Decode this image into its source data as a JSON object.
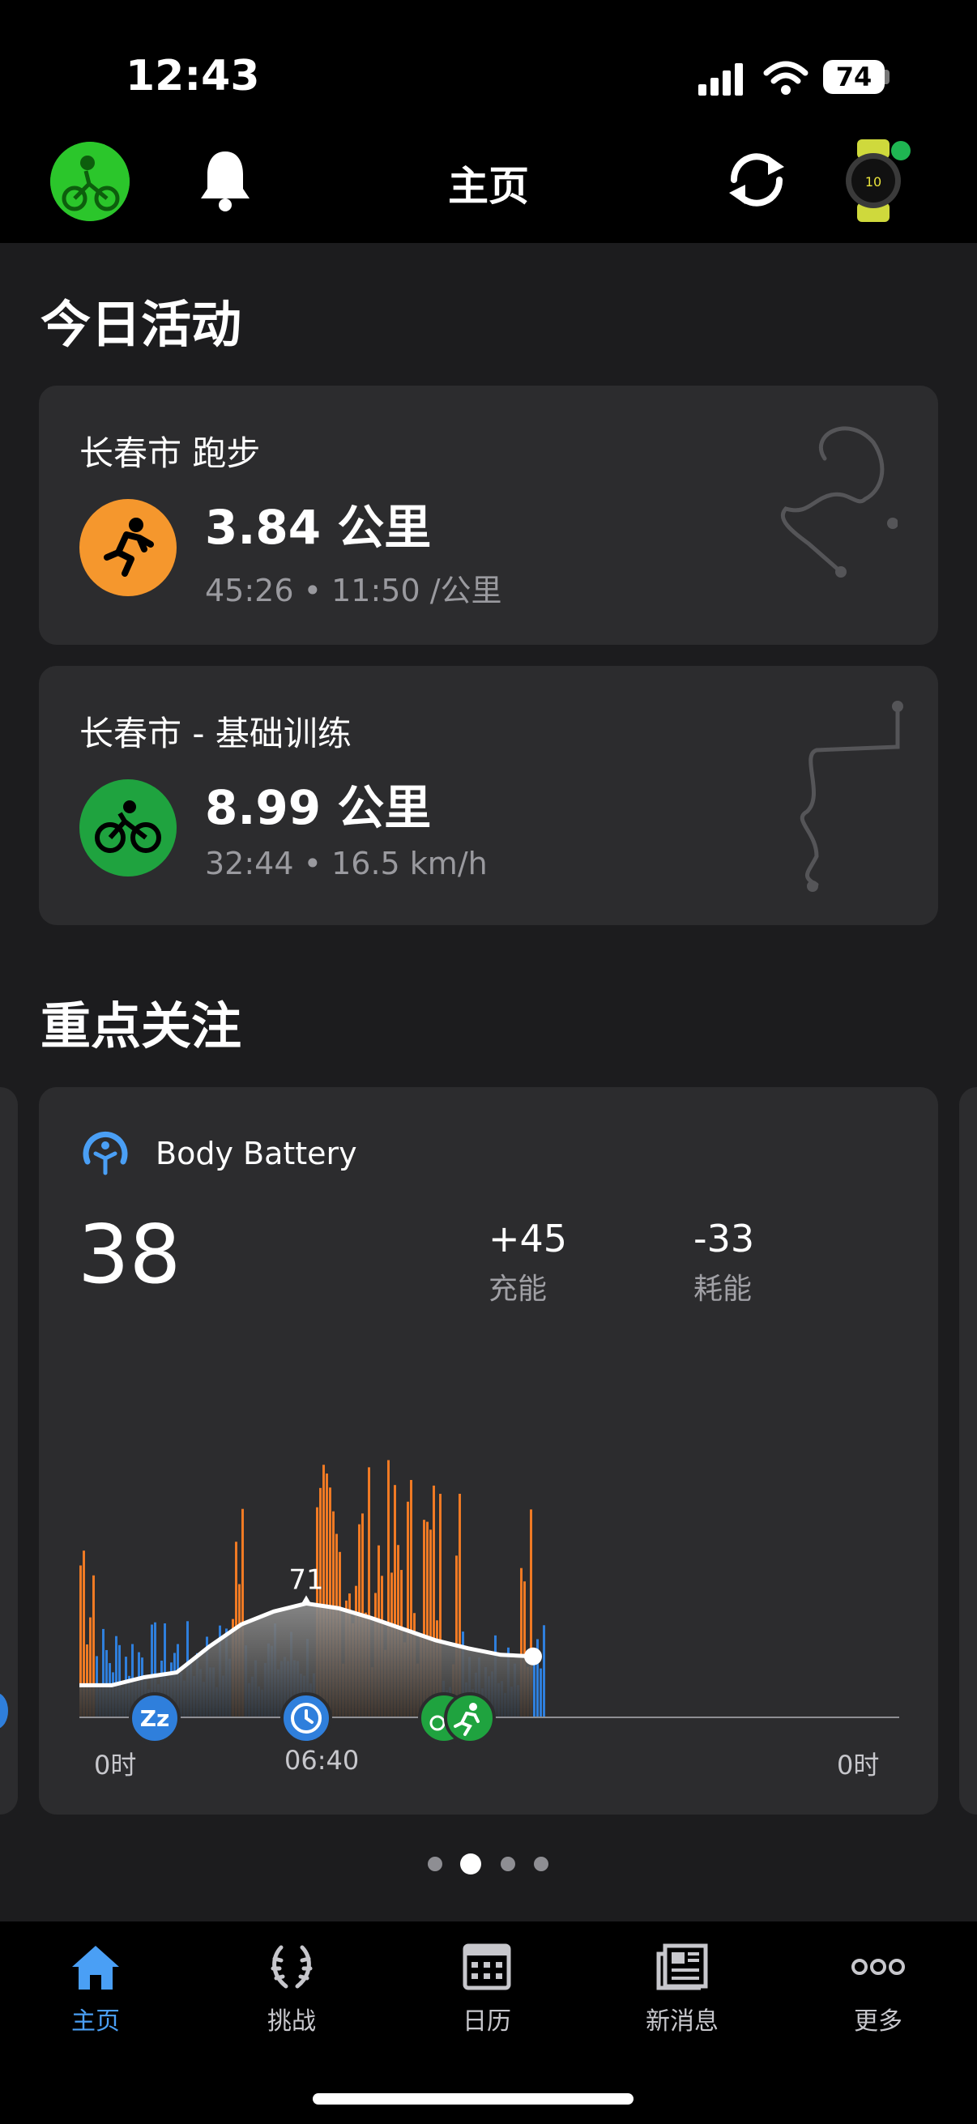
{
  "status_bar": {
    "time": "12:43",
    "battery": "74"
  },
  "header": {
    "title": "主页"
  },
  "today": {
    "section_title": "今日活动",
    "activities": [
      {
        "title": "长春市 跑步",
        "distance": "3.84 公里",
        "duration": "45:26",
        "pace": "11:50 /公里",
        "icon": "run-icon",
        "color": "#f5972d"
      },
      {
        "title": "长春市 - 基础训练",
        "distance": "8.99 公里",
        "duration": "32:44",
        "pace": "16.5 km/h",
        "icon": "bike-icon",
        "color": "#1fa33f"
      }
    ]
  },
  "focus": {
    "section_title": "重点关注",
    "body_battery": {
      "title": "Body Battery",
      "current": "38",
      "charged": {
        "value": "+45",
        "label": "充能"
      },
      "drained": {
        "value": "-33",
        "label": "耗能"
      },
      "peak_label": "71",
      "axis_labels": [
        "0时",
        "06:40",
        "0时"
      ]
    }
  },
  "chart_data": {
    "type": "area",
    "title": "Body Battery",
    "ylim": [
      0,
      100
    ],
    "x": [
      "00:00",
      "01:00",
      "02:00",
      "03:00",
      "04:00",
      "05:00",
      "06:00",
      "06:40",
      "07:00",
      "08:00",
      "09:00",
      "10:00",
      "11:00",
      "12:00",
      "12:43"
    ],
    "series": [
      {
        "values": [
          20,
          20,
          25,
          28,
          44,
          58,
          66,
          71,
          68,
          62,
          55,
          48,
          43,
          39,
          38
        ]
      }
    ],
    "peak": 71,
    "colors": {
      "stress": "#f07a24",
      "rest": "#2f7fdc",
      "line": "#ffffff"
    }
  },
  "pager": {
    "count": 4,
    "active": 1
  },
  "bottom_nav": [
    {
      "label": "主页",
      "icon": "home-icon",
      "active": true
    },
    {
      "label": "挑战",
      "icon": "laurel-icon",
      "active": false
    },
    {
      "label": "日历",
      "icon": "calendar-icon",
      "active": false
    },
    {
      "label": "新消息",
      "icon": "news-icon",
      "active": false
    },
    {
      "label": "更多",
      "icon": "more-icon",
      "active": false
    }
  ],
  "colors": {
    "accent": "#4a9ff5",
    "background": "#1c1c1e",
    "card": "#2c2c2e"
  }
}
